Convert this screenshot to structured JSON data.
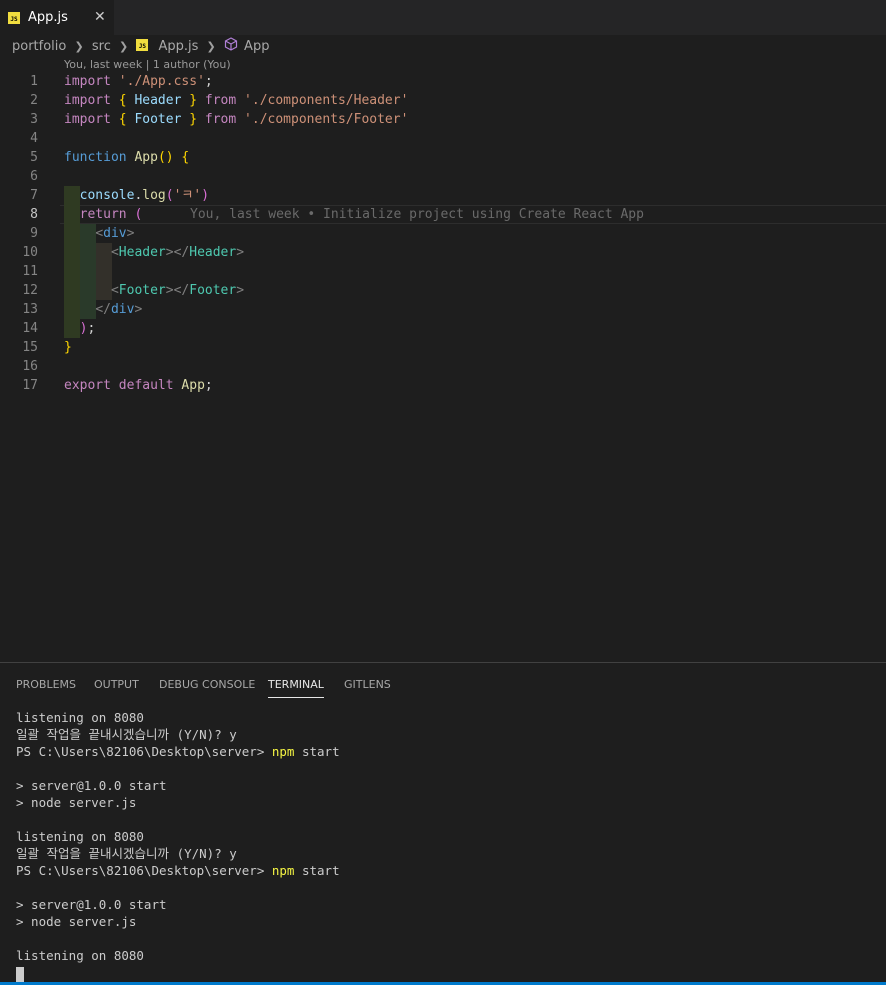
{
  "tab": {
    "label": "App.js",
    "close": "✕",
    "icon": "JS"
  },
  "breadcrumb": {
    "folder": "portfolio",
    "subfolder": "src",
    "file": "App.js",
    "symbol": "App"
  },
  "codelens": "You, last week | 1 author (You)",
  "code_lines": [
    {
      "n": "1",
      "html": "<span class=\"kw\">import</span> <span class=\"str\">'./App.css'</span>;"
    },
    {
      "n": "2",
      "html": "<span class=\"kw\">import</span> <span class=\"br1\">{</span> <span class=\"var\">Header</span> <span class=\"br1\">}</span> <span class=\"kw\">from</span> <span class=\"str\">'./components/Header'</span>"
    },
    {
      "n": "3",
      "html": "<span class=\"kw\">import</span> <span class=\"br1\">{</span> <span class=\"var\">Footer</span> <span class=\"br1\">}</span> <span class=\"kw\">from</span> <span class=\"str\">'./components/Footer'</span>"
    },
    {
      "n": "4",
      "html": ""
    },
    {
      "n": "5",
      "html": "<span class=\"blue\">function</span> <span class=\"fn\">App</span><span class=\"br1\">()</span> <span class=\"br1\">{</span>"
    },
    {
      "n": "6",
      "html": ""
    },
    {
      "n": "7",
      "html": "  <span class=\"var\">console</span>.<span class=\"fn\">log</span><span class=\"br2\">(</span><span class=\"str\">'ㅋ'</span><span class=\"br2\">)</span>"
    },
    {
      "n": "8",
      "html": "  <span class=\"kw\">return</span> <span class=\"br2\">(</span>"
    },
    {
      "n": "9",
      "html": "    <span class=\"tagp\">&lt;</span><span class=\"blue\">div</span><span class=\"tagp\">&gt;</span>"
    },
    {
      "n": "10",
      "html": "      <span class=\"tagp\">&lt;</span><span class=\"tag\">Header</span><span class=\"tagp\">&gt;&lt;/</span><span class=\"tag\">Header</span><span class=\"tagp\">&gt;</span>"
    },
    {
      "n": "11",
      "html": ""
    },
    {
      "n": "12",
      "html": "      <span class=\"tagp\">&lt;</span><span class=\"tag\">Footer</span><span class=\"tagp\">&gt;&lt;/</span><span class=\"tag\">Footer</span><span class=\"tagp\">&gt;</span>"
    },
    {
      "n": "13",
      "html": "    <span class=\"tagp\">&lt;/</span><span class=\"blue\">div</span><span class=\"tagp\">&gt;</span>"
    },
    {
      "n": "14",
      "html": "  <span class=\"br2\">)</span>;"
    },
    {
      "n": "15",
      "html": "<span class=\"br1\">}</span>"
    },
    {
      "n": "16",
      "html": ""
    },
    {
      "n": "17",
      "html": "<span class=\"kw\">export</span> <span class=\"kw\">default</span> <span class=\"fn\">App</span>;"
    }
  ],
  "blame_line": "You, last week • Initialize project using Create React App",
  "panel_tabs": [
    "PROBLEMS",
    "OUTPUT",
    "DEBUG CONSOLE",
    "TERMINAL",
    "GITLENS"
  ],
  "terminal_lines": [
    {
      "text": "listening on 8080"
    },
    {
      "text": "일괄 작업을 끝내시겠습니까 (Y/N)? y"
    },
    {
      "prompt": "PS C:\\Users\\82106\\Desktop\\server> ",
      "cmd": "npm",
      "rest": " start"
    },
    {
      "text": ""
    },
    {
      "text": "> server@1.0.0 start"
    },
    {
      "text": "> node server.js"
    },
    {
      "text": ""
    },
    {
      "text": "listening on 8080"
    },
    {
      "text": "일괄 작업을 끝내시겠습니까 (Y/N)? y"
    },
    {
      "prompt": "PS C:\\Users\\82106\\Desktop\\server> ",
      "cmd": "npm",
      "rest": " start"
    },
    {
      "text": ""
    },
    {
      "text": "> server@1.0.0 start"
    },
    {
      "text": "> node server.js"
    },
    {
      "text": ""
    },
    {
      "text": "listening on 8080"
    }
  ],
  "colors": {
    "accent": "#007acc",
    "background": "#1e1e1e",
    "js_icon": "#f1dd3f"
  }
}
